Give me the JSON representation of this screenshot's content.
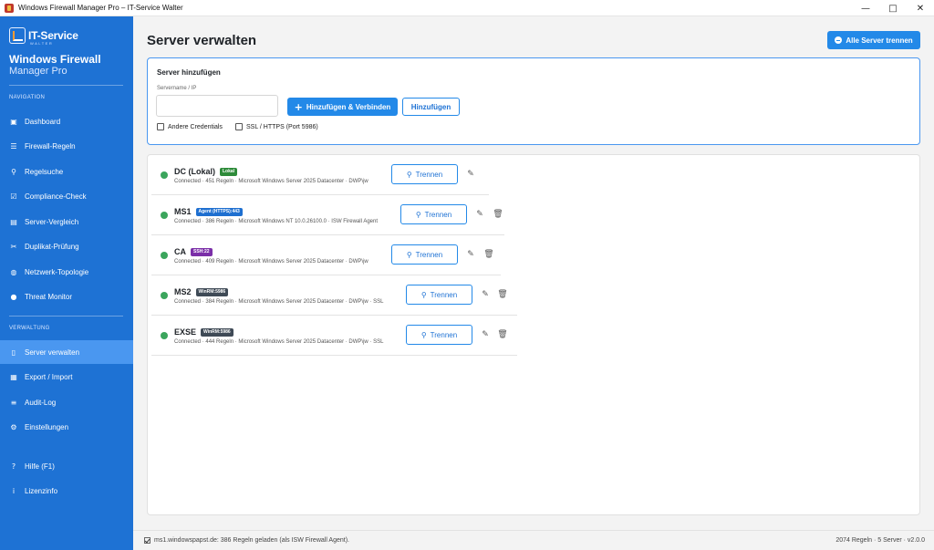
{
  "window": {
    "title": "Windows Firewall Manager Pro – IT-Service Walter",
    "minimize": "—",
    "maximize": "□",
    "close": "✕"
  },
  "sidebar": {
    "brand_name": "IT-Service",
    "brand_sub": "WALTER",
    "app_title": "Windows Firewall",
    "app_subtitle": "Manager Pro",
    "section_navigation": "NAVIGATION",
    "section_verwaltung": "VERWALTUNG",
    "nav_items": [
      {
        "label": "Dashboard",
        "icon": "▣"
      },
      {
        "label": "Firewall-Regeln",
        "icon": "☰"
      },
      {
        "label": "Regelsuche",
        "icon": "⚲"
      },
      {
        "label": "Compliance-Check",
        "icon": "☑"
      },
      {
        "label": "Server-Vergleich",
        "icon": "▤"
      },
      {
        "label": "Duplikat-Prüfung",
        "icon": "✂"
      },
      {
        "label": "Netzwerk-Topologie",
        "icon": "◍"
      },
      {
        "label": "Threat Monitor",
        "icon": "●"
      }
    ],
    "admin_items": [
      {
        "label": "Server verwalten",
        "icon": "▯",
        "active": true
      },
      {
        "label": "Export / Import",
        "icon": "▦"
      },
      {
        "label": "Audit-Log",
        "icon": "≡"
      },
      {
        "label": "Einstellungen",
        "icon": "⚙"
      }
    ],
    "help_items": [
      {
        "label": "Hilfe (F1)",
        "icon": "?"
      },
      {
        "label": "Lizenzinfo",
        "icon": "i"
      }
    ]
  },
  "main": {
    "title": "Server verwalten",
    "disconnect_all_label": "Alle Server trennen",
    "add_server": {
      "title": "Server hinzufügen",
      "field_label": "Servername / IP",
      "field_value": "",
      "add_connect_label": "Hinzufügen & Verbinden",
      "add_label": "Hinzufügen",
      "other_credentials_label": "Andere Credentials",
      "ssl_label": "SSL / HTTPS (Port 5986)"
    },
    "disconnect_label": "Trennen",
    "servers": [
      {
        "name": "DC (Lokal)",
        "badge": "Lokal",
        "badge_color": "#2e8b3a",
        "info": "Connected · 451 Regeln · Microsoft Windows Server 2025 Datacenter · DWP\\jw",
        "status_color": "#3ba55c"
      },
      {
        "name": "MS1",
        "badge": "Agent (HTTPS):443",
        "badge_color": "#1e6fd0",
        "info": "Connected · 386 Regeln · Microsoft Windows NT 10.0.26100.0 · ISW Firewall Agent",
        "status_color": "#3ba55c"
      },
      {
        "name": "CA",
        "badge": "SSH:22",
        "badge_color": "#7b2fa8",
        "info": "Connected · 409 Regeln · Microsoft Windows Server 2025 Datacenter · DWP\\jw",
        "status_color": "#3ba55c"
      },
      {
        "name": "MS2",
        "badge": "WinRM:5986",
        "badge_color": "#3f4a56",
        "info": "Connected · 384 Regeln · Microsoft Windows Server 2025 Datacenter · DWP\\jw · SSL",
        "status_color": "#3ba55c"
      },
      {
        "name": "EXSE",
        "badge": "WinRM:5986",
        "badge_color": "#3f4a56",
        "info": "Connected · 444 Regeln · Microsoft Windows Server 2025 Datacenter · DWP\\jw · SSL",
        "status_color": "#3ba55c"
      }
    ]
  },
  "statusbar": {
    "left": "ms1.windowspapst.de: 386 Regeln geladen (als ISW Firewall Agent).",
    "right": "2074 Regeln · 5 Server · v2.0.0"
  },
  "colors": {
    "sidebar": "#1e72d4",
    "sidebar_active": "#4a97f0",
    "accent": "#2389e8",
    "connected": "#3ba55c"
  }
}
